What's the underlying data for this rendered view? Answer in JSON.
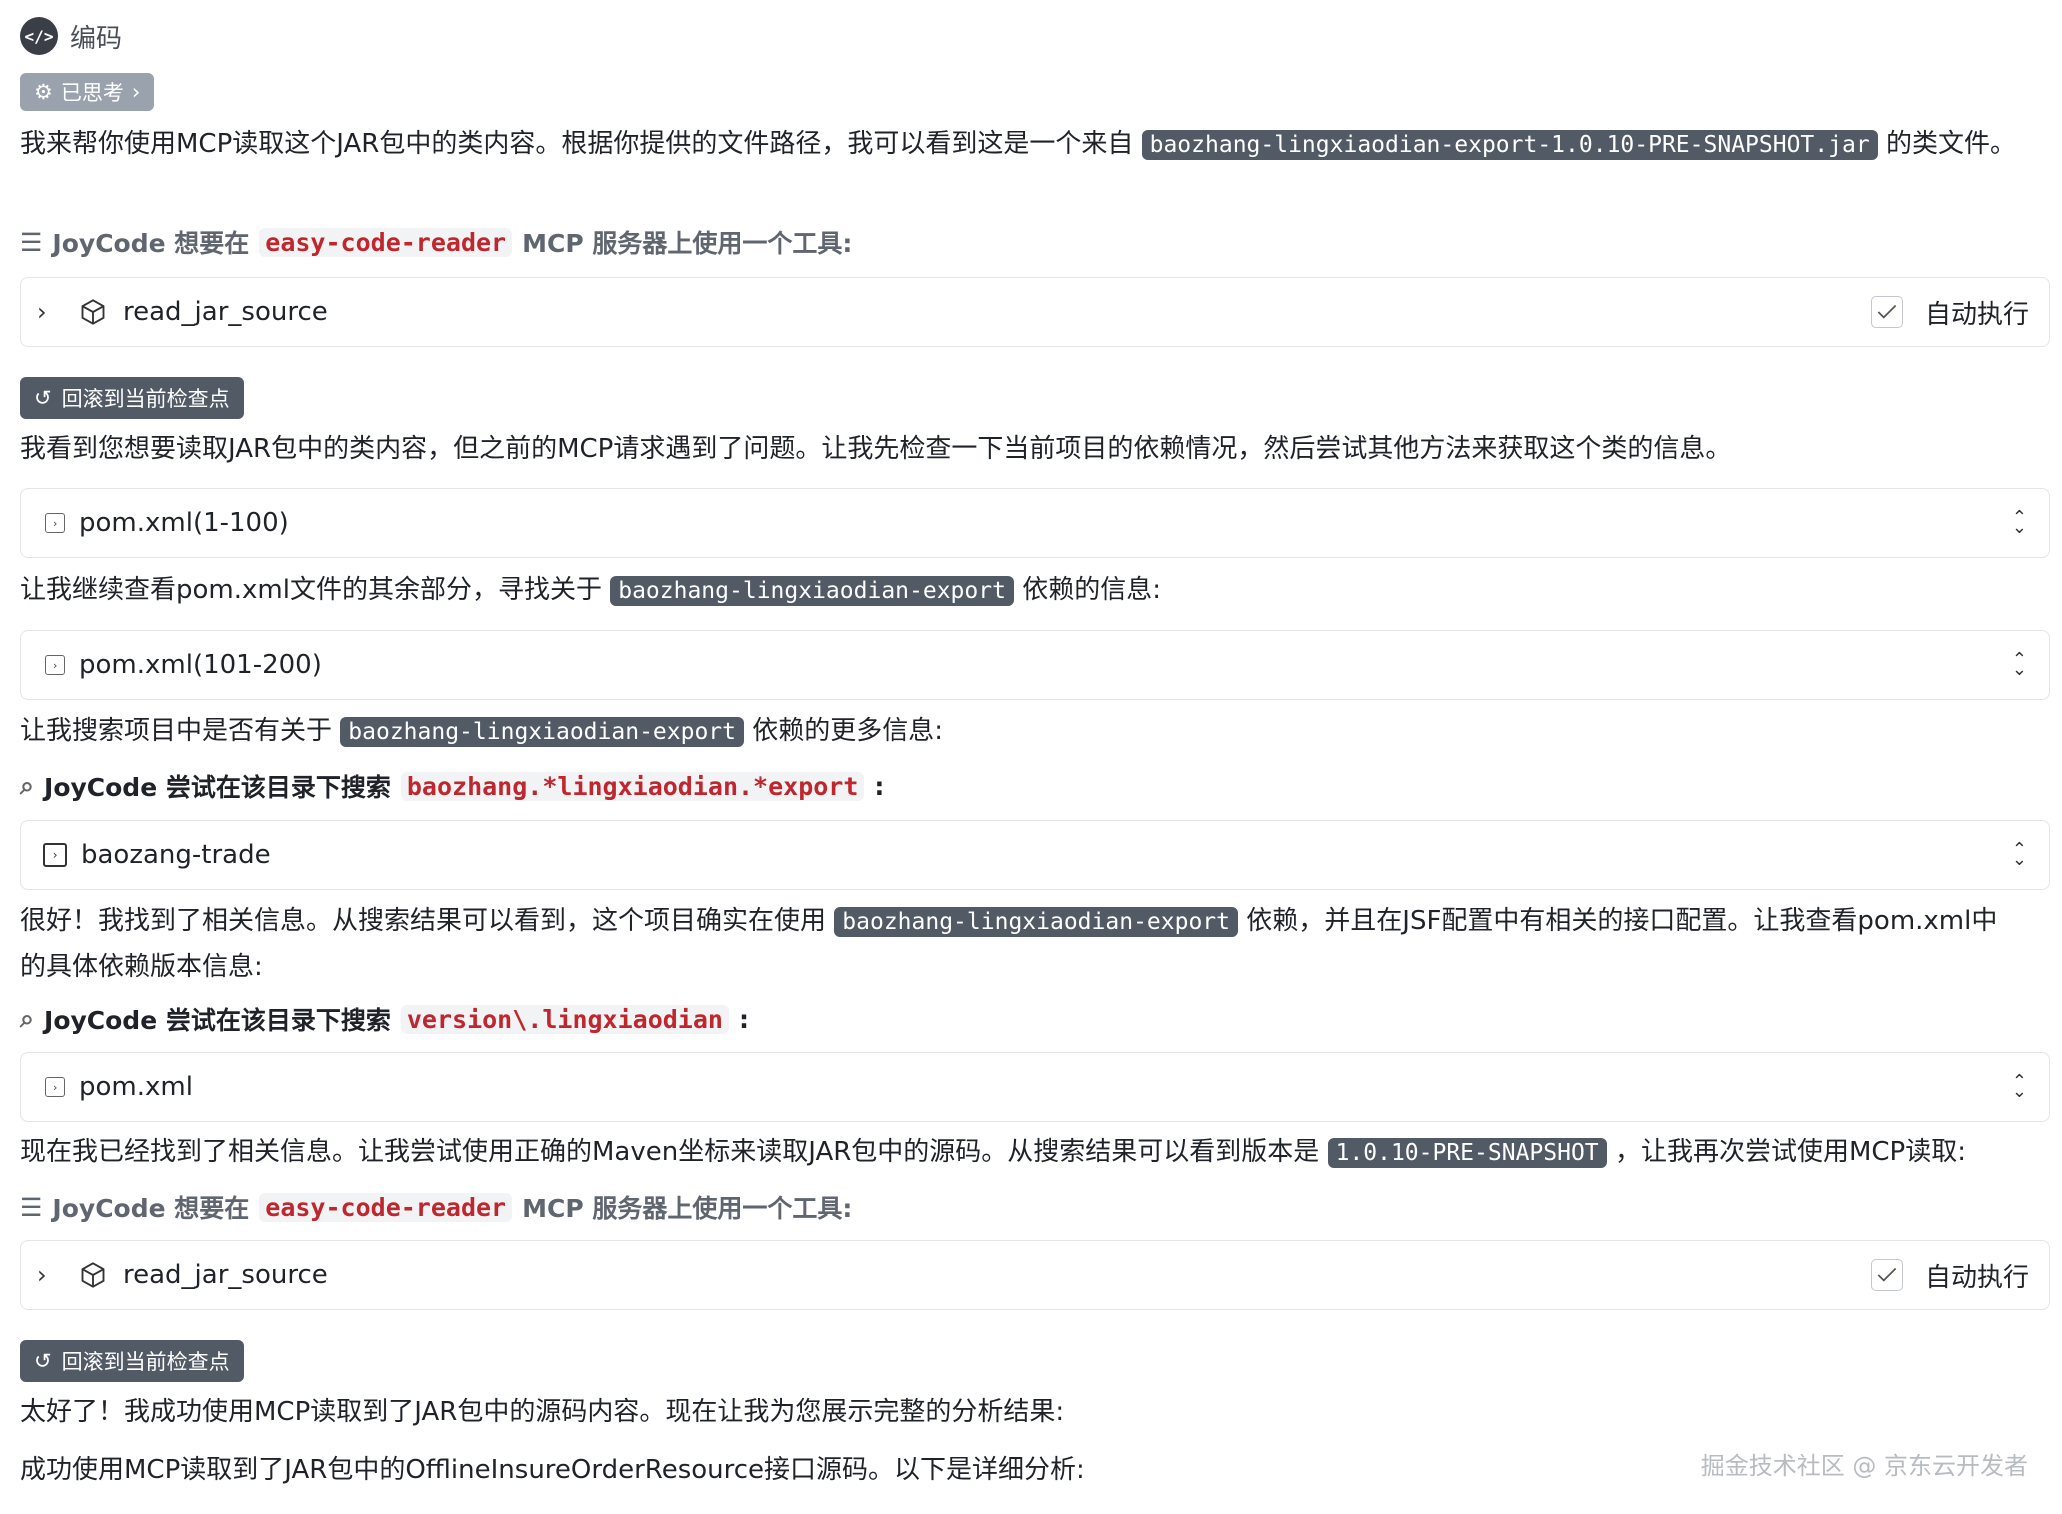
{
  "header": {
    "icon": "code-icon",
    "title": "编码"
  },
  "thought_chip": {
    "label": "已思考"
  },
  "p1": {
    "text_before": "我来帮你使用MCP读取这个JAR包中的类内容。根据你提供的文件路径，我可以看到这是一个来自",
    "code": "baozhang-lingxiaodian-export-1.0.10-PRE-SNAPSHOT.jar",
    "text_after": "的类文件。"
  },
  "tool1": {
    "prefix": "JoyCode 想要在",
    "server": "easy-code-reader",
    "suffix": "MCP 服务器上使用一个工具:"
  },
  "card1": {
    "name": "read_jar_source",
    "auto_label": "自动执行"
  },
  "rollback1": {
    "label": "回滚到当前检查点"
  },
  "p2": {
    "text": "我看到您想要读取JAR包中的类内容，但之前的MCP请求遇到了问题。让我先检查一下当前项目的依赖情况，然后尝试其他方法来获取这个类的信息。"
  },
  "card2": {
    "name": "pom.xml(1-100)"
  },
  "p3": {
    "text_before": "让我继续查看pom.xml文件的其余部分，寻找关于",
    "code": "baozhang-lingxiaodian-export",
    "text_after": "依赖的信息:"
  },
  "card3": {
    "name": "pom.xml(101-200)"
  },
  "p4": {
    "text_before": "让我搜索项目中是否有关于",
    "code": "baozhang-lingxiaodian-export",
    "text_after": "依赖的更多信息:"
  },
  "search1": {
    "prefix": "JoyCode 尝试在该目录下搜索",
    "pattern": "baozhang.*lingxiaodian.*export",
    "suffix": ":"
  },
  "card4": {
    "name": "baozang-trade"
  },
  "p5": {
    "text_before": "很好！我找到了相关信息。从搜索结果可以看到，这个项目确实在使用",
    "code": "baozhang-lingxiaodian-export",
    "text_after": "依赖，并且在JSF配置中有相关的接口配置。让我查看pom.xml中的具体依赖版本信息:"
  },
  "search2": {
    "prefix": "JoyCode 尝试在该目录下搜索",
    "pattern": "version\\.lingxiaodian",
    "suffix": ":"
  },
  "card5": {
    "name": "pom.xml"
  },
  "p6": {
    "text_before": "现在我已经找到了相关信息。让我尝试使用正确的Maven坐标来读取JAR包中的源码。从搜索结果可以看到版本是",
    "code": "1.0.10-PRE-SNAPSHOT",
    "text_after": "，让我再次尝试使用MCP读取:"
  },
  "tool2": {
    "prefix": "JoyCode 想要在",
    "server": "easy-code-reader",
    "suffix": "MCP 服务器上使用一个工具:"
  },
  "card6": {
    "name": "read_jar_source",
    "auto_label": "自动执行"
  },
  "rollback2": {
    "label": "回滚到当前检查点"
  },
  "p7": {
    "text": "太好了！我成功使用MCP读取到了JAR包中的源码内容。现在让我为您展示完整的分析结果:"
  },
  "p8": {
    "text": "成功使用MCP读取到了JAR包中的OfflineInsureOrderResource接口源码。以下是详细分析:"
  },
  "watermark": {
    "text": "掘金技术社区 @ 京东云开发者"
  }
}
